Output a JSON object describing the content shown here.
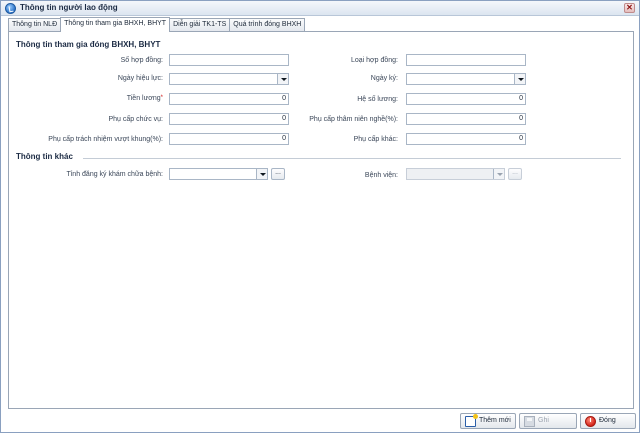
{
  "window": {
    "title": "Thông tin người lao động",
    "close_glyph": "✕"
  },
  "tabs": [
    {
      "label": "Thông tin NLĐ"
    },
    {
      "label": "Thông tin tham gia BHXH, BHYT"
    },
    {
      "label": "Diễn giải TK1-TS"
    },
    {
      "label": "Quá trình đóng BHXH"
    }
  ],
  "section1": {
    "title": "Thông tin tham gia đóng BHXH, BHYT",
    "so_hop_dong": {
      "label": "Số hợp đồng:",
      "value": ""
    },
    "loai_hop_dong": {
      "label": "Loại hợp đồng:",
      "value": ""
    },
    "ngay_hieu_luc": {
      "label": "Ngày hiệu lực:",
      "value": ""
    },
    "ngay_ky": {
      "label": "Ngày ký:",
      "value": ""
    },
    "tien_luong": {
      "label": "Tiền lương",
      "required_mark": "*",
      "value": "0"
    },
    "he_so_luong": {
      "label": "Hệ số lương:",
      "value": "0"
    },
    "phu_cap_chuc_vu": {
      "label": "Phụ cấp chức vụ:",
      "value": "0"
    },
    "phu_cap_tham_nien_nghe": {
      "label": "Phụ cấp thâm niên nghề(%):",
      "value": "0"
    },
    "phu_cap_trach_nhiem": {
      "label": "Phụ cấp trách nhiệm vượt khung(%):",
      "value": "0"
    },
    "phu_cap_khac": {
      "label": "Phụ cấp khác:",
      "value": "0"
    }
  },
  "section2": {
    "title": "Thông tin khác",
    "tinh_dang_ky": {
      "label": "Tỉnh đăng ký khám chữa bệnh:",
      "value": "",
      "ellipsis": "..."
    },
    "benh_vien": {
      "label": "Bệnh viện:",
      "value": "",
      "ellipsis": "..."
    }
  },
  "footer": {
    "add_label": "Thêm mới",
    "save_label": "Ghi",
    "close_label": "Đóng"
  },
  "colors": {
    "accent": "#2a72c8",
    "close_icon": "#d4251a",
    "required": "#d01010"
  }
}
